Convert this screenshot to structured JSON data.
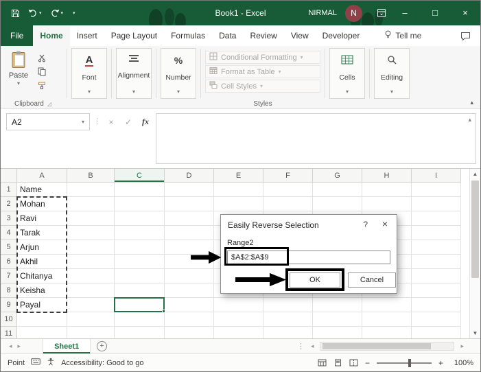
{
  "titlebar": {
    "title": "Book1 - Excel",
    "user_name": "NIRMAL",
    "avatar_initial": "N"
  },
  "tabs": {
    "items": [
      "File",
      "Home",
      "Insert",
      "Page Layout",
      "Formulas",
      "Data",
      "Review",
      "View",
      "Developer"
    ],
    "selected": "Home",
    "tell_me": "Tell me"
  },
  "ribbon": {
    "paste_label": "Paste",
    "clipboard_label": "Clipboard",
    "font_label": "Font",
    "alignment_label": "Alignment",
    "number_label": "Number",
    "conditional_formatting": "Conditional Formatting",
    "format_as_table": "Format as Table",
    "cell_styles": "Cell Styles",
    "styles_label": "Styles",
    "cells_label": "Cells",
    "editing_label": "Editing"
  },
  "formula_bar": {
    "name_box_value": "A2",
    "fx_label": "fx"
  },
  "grid": {
    "columns": [
      "A",
      "B",
      "C",
      "D",
      "E",
      "F",
      "G",
      "H",
      "I"
    ],
    "rows": [
      "1",
      "2",
      "3",
      "4",
      "5",
      "6",
      "7",
      "8",
      "9",
      "10",
      "11"
    ],
    "col_a_values": [
      "Name",
      "Mohan",
      "Ravi",
      "Tarak",
      "Arjun",
      "Akhil",
      "Chitanya",
      "Keisha",
      "Payal"
    ],
    "active_column": "C",
    "active_cell": "C9",
    "selected_range": "A2:A9"
  },
  "dialog": {
    "title": "Easily Reverse Selection",
    "range_label": "Range2",
    "range_value": "$A$2:$A$9",
    "ok_label": "OK",
    "cancel_label": "Cancel"
  },
  "sheet_bar": {
    "sheet1": "Sheet1"
  },
  "status_bar": {
    "mode": "Point",
    "accessibility": "Accessibility: Good to go",
    "zoom_level": "100%"
  },
  "icons": {
    "dropdown": "▾",
    "collapse": "▴",
    "close": "×",
    "help": "?",
    "check": "✓",
    "cancel_x": "×",
    "vdots": "⋮",
    "left": "◂",
    "right": "▸",
    "up": "▲",
    "down": "▼",
    "plus": "+",
    "minus": "−",
    "minimize": "–",
    "maximize": "□",
    "font_a": "A",
    "percent": "%",
    "launcher": "◿"
  },
  "colors": {
    "titlebar_green": "#185C37",
    "accent_green": "#217346",
    "annotation": "#000000",
    "disabled_text": "#a8a6a3"
  }
}
